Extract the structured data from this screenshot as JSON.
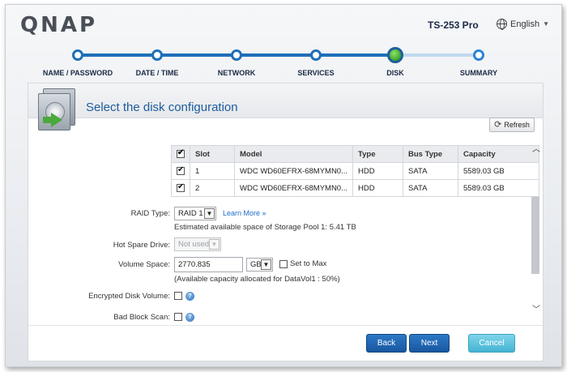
{
  "header": {
    "logo": "QNAP",
    "model": "TS-253 Pro",
    "language": "English"
  },
  "wizard": {
    "steps": [
      {
        "label": "NAME / PASSWORD",
        "state": "done"
      },
      {
        "label": "DATE / TIME",
        "state": "done"
      },
      {
        "label": "NETWORK",
        "state": "done"
      },
      {
        "label": "SERVICES",
        "state": "done"
      },
      {
        "label": "DISK",
        "state": "current"
      },
      {
        "label": "SUMMARY",
        "state": "todo"
      }
    ]
  },
  "panel": {
    "title": "Select the disk configuration",
    "refresh_label": "Refresh"
  },
  "disk_table": {
    "columns": [
      "Slot",
      "Model",
      "Type",
      "Bus Type",
      "Capacity"
    ],
    "rows": [
      {
        "checked": true,
        "slot": "1",
        "model": "WDC WD60EFRX-68MYMN0...",
        "type": "HDD",
        "bus": "SATA",
        "capacity": "5589.03 GB"
      },
      {
        "checked": true,
        "slot": "2",
        "model": "WDC WD60EFRX-68MYMN0...",
        "type": "HDD",
        "bus": "SATA",
        "capacity": "5589.03 GB"
      }
    ],
    "header_checked": true
  },
  "form": {
    "raid_type_label": "RAID Type:",
    "raid_type_value": "RAID 1",
    "learn_more": "Learn More »",
    "estimated_space": "Estimated available space of Storage Pool 1: 5.41 TB",
    "hot_spare_label": "Hot Spare Drive:",
    "hot_spare_value": "Not used",
    "volume_space_label": "Volume Space:",
    "volume_space_value": "2770.835",
    "volume_unit": "GB",
    "set_to_max_label": "Set to Max",
    "capacity_note": "(Available capacity allocated for DataVol1 : 50%)",
    "encrypted_label": "Encrypted Disk Volume:",
    "bad_block_label": "Bad Block Scan:"
  },
  "footer": {
    "back_label": "Back",
    "next_label": "Next",
    "cancel_label": "Cancel"
  },
  "colors": {
    "accent": "#1f6fb8",
    "title": "#1c5c9c",
    "current_step": "#3aa52b",
    "cancel": "#45b4d3"
  }
}
